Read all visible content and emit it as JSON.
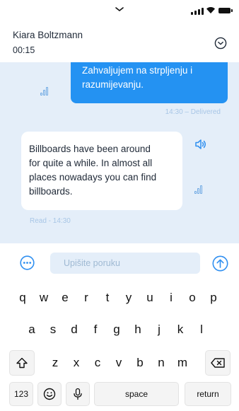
{
  "status_bar": {
    "icons": [
      "chevron-down-icon",
      "signal-icon",
      "wifi-icon",
      "battery-icon"
    ]
  },
  "header": {
    "contact_name": "Kiara Boltzmann",
    "call_timer": "00:15",
    "menu_icon": "chevron-circle-icon"
  },
  "messages": [
    {
      "direction": "outgoing",
      "text_lines": [
        "Zahvaljujem na strpljenju i",
        "razumijevanju."
      ],
      "meta": "14:30 – Delivered",
      "icons": [
        "audio-wave-icon"
      ]
    },
    {
      "direction": "incoming",
      "text_lines": [
        "Billboards have been around",
        "for quite a while. In almost all",
        "places nowadays you can find",
        "billboards."
      ],
      "meta": "Read - 14:30",
      "icons": [
        "speaker-icon",
        "audio-wave-icon"
      ]
    }
  ],
  "composer": {
    "placeholder": "Upišite poruku",
    "value": "",
    "left_icon": "more-icon",
    "right_icon": "send-up-arrow-icon"
  },
  "keyboard": {
    "row1": [
      "q",
      "w",
      "e",
      "r",
      "t",
      "y",
      "u",
      "i",
      "o",
      "p"
    ],
    "row2": [
      "a",
      "s",
      "d",
      "f",
      "g",
      "h",
      "j",
      "k",
      "l"
    ],
    "row3": [
      "z",
      "x",
      "c",
      "v",
      "b",
      "n",
      "m"
    ],
    "shift_icon": "shift-icon",
    "backspace_icon": "backspace-icon",
    "numbers_label": "123",
    "emoji_icon": "emoji-icon",
    "mic_icon": "mic-icon",
    "space_label": "space",
    "return_label": "return"
  },
  "colors": {
    "accent": "#2492f2",
    "chat_background": "#e4eef9",
    "meta_text": "#a8c6e6",
    "icon_blue": "#2f8ff0"
  }
}
